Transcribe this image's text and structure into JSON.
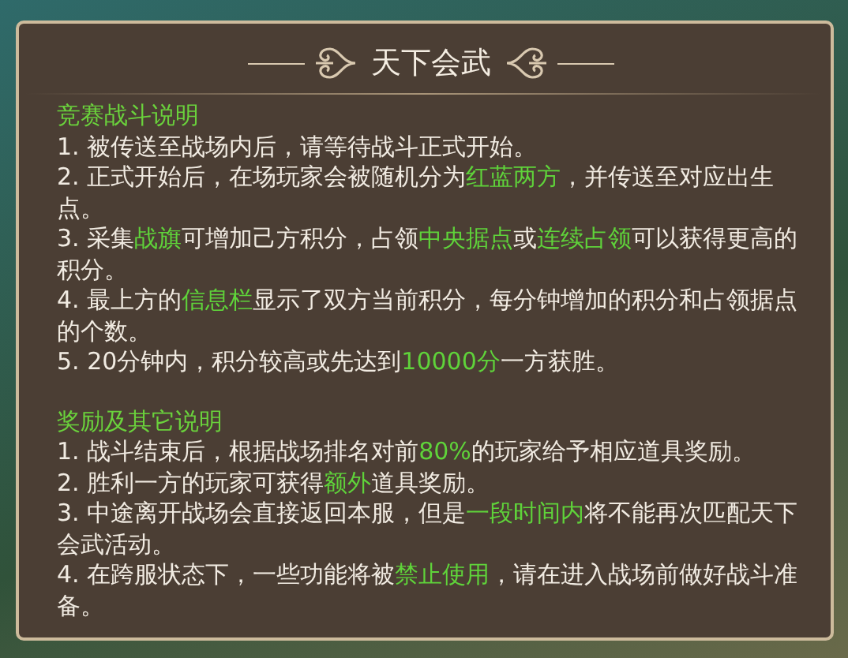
{
  "dialog": {
    "title": "天下会武",
    "sections": [
      {
        "heading": "竞赛战斗说明",
        "lines": [
          [
            {
              "text": "1. 被传送至战场内后，请等待战斗正式开始。",
              "highlight": false
            }
          ],
          [
            {
              "text": "2. 正式开始后，在场玩家会被随机分为",
              "highlight": false
            },
            {
              "text": "红蓝两方",
              "highlight": true
            },
            {
              "text": "，并传送至对应出生点。",
              "highlight": false
            }
          ],
          [
            {
              "text": "3. 采集",
              "highlight": false
            },
            {
              "text": "战旗",
              "highlight": true
            },
            {
              "text": "可增加己方积分，占领",
              "highlight": false
            },
            {
              "text": "中央据点",
              "highlight": true
            },
            {
              "text": "或",
              "highlight": false
            },
            {
              "text": "连续占领",
              "highlight": true
            },
            {
              "text": "可以获得更高的积分。",
              "highlight": false
            }
          ],
          [
            {
              "text": "4. 最上方的",
              "highlight": false
            },
            {
              "text": "信息栏",
              "highlight": true
            },
            {
              "text": "显示了双方当前积分，每分钟增加的积分和占领据点的个数。",
              "highlight": false
            }
          ],
          [
            {
              "text": "5. 20分钟内，积分较高或先达到",
              "highlight": false
            },
            {
              "text": "10000分",
              "highlight": true
            },
            {
              "text": "一方获胜。",
              "highlight": false
            }
          ]
        ]
      },
      {
        "heading": "奖励及其它说明",
        "lines": [
          [
            {
              "text": "1. 战斗结束后，根据战场排名对前",
              "highlight": false
            },
            {
              "text": "80%",
              "highlight": true
            },
            {
              "text": "的玩家给予相应道具奖励。",
              "highlight": false
            }
          ],
          [
            {
              "text": "2. 胜利一方的玩家可获得",
              "highlight": false
            },
            {
              "text": "额外",
              "highlight": true
            },
            {
              "text": "道具奖励。",
              "highlight": false
            }
          ],
          [
            {
              "text": "3. 中途离开战场会直接返回本服，但是",
              "highlight": false
            },
            {
              "text": "一段时间内",
              "highlight": true
            },
            {
              "text": "将不能再次匹配天下会武活动。",
              "highlight": false
            }
          ],
          [
            {
              "text": "4. 在跨服状态下，一些功能将被",
              "highlight": false
            },
            {
              "text": "禁止使用",
              "highlight": true
            },
            {
              "text": "，请在进入战场前做好战斗准备。",
              "highlight": false
            }
          ]
        ]
      }
    ]
  }
}
